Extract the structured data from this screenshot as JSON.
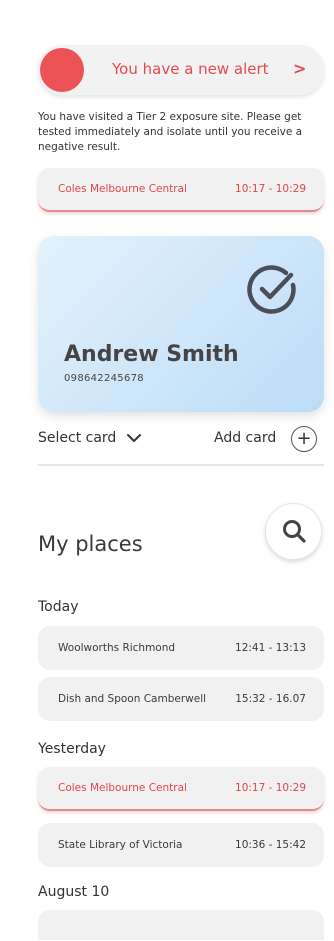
{
  "alert": {
    "title": "You have a new alert",
    "chevron": ">",
    "message": "You have visited a Tier 2 exposure site. Please get tested immediately and isolate until you receive a negative result.",
    "visit": {
      "place": "Coles Melbourne Central",
      "time": "10:17 - 10:29"
    },
    "color": "#e44a4f"
  },
  "card": {
    "name": "Andrew Smith",
    "number": "098642245678",
    "select_label": "Select card",
    "add_label": "Add card",
    "add_symbol": "+"
  },
  "places": {
    "title": "My places",
    "groups": [
      {
        "label": "Today",
        "items": [
          {
            "place": "Woolworths Richmond",
            "time": "12:41 - 13:13",
            "alert": false
          },
          {
            "place": "Dish and Spoon Camberwell",
            "time": "15:32 - 16.07",
            "alert": false
          }
        ]
      },
      {
        "label": "Yesterday",
        "items": [
          {
            "place": "Coles Melbourne Central",
            "time": "10:17 - 10:29",
            "alert": true
          },
          {
            "place": "State Library of Victoria",
            "time": "10:36 - 15:42",
            "alert": false
          }
        ]
      },
      {
        "label": "August 10",
        "items": []
      }
    ]
  },
  "icons": {
    "alert_dot": "red-circle-icon",
    "card_check": "check-circle-icon",
    "select": "chevron-down-icon",
    "add": "plus-circle-icon",
    "search": "search-icon"
  }
}
